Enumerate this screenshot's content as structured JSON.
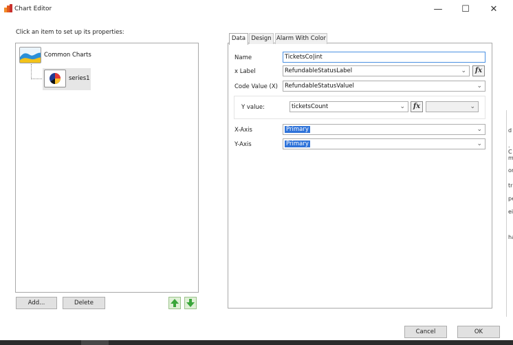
{
  "window": {
    "title": "Chart Editor",
    "minimize": "—",
    "maximize": "☐",
    "close": "✕"
  },
  "left": {
    "caption": "Click an item to set up  its properties:",
    "tree": [
      {
        "label": "Common Charts",
        "icon": "area-chart-icon"
      },
      {
        "label": "series1",
        "icon": "pie-chart-icon"
      }
    ],
    "add_label": "Add...",
    "delete_label": "Delete"
  },
  "tabs": [
    "Data",
    "Design",
    "Alarm With Color"
  ],
  "form": {
    "name_label": "Name",
    "name_value": "TicketsCo|int",
    "xlabel_label": "x Label",
    "xlabel_value": "RefundableStatusLabel",
    "code_label": "Code Value (X)",
    "code_value": "RefundableStatusValuel",
    "y_label": "Y value:",
    "y_value": "ticketsCount",
    "y_extra": "",
    "xaxis_label": "X-Axis",
    "xaxis_value": "Primary",
    "yaxis_label": "Y-Axis",
    "yaxis_value": "Primary",
    "fx_label": "fx"
  },
  "footer": {
    "cancel_label": "Cancel",
    "ok_label": "OK"
  },
  "edge_text": [
    "d",
    ". C",
    "m",
    "or",
    "tr",
    "pe",
    "ei",
    "ha"
  ],
  "colors": {
    "accent": "#2f73d9",
    "focus_border": "#4a90e2",
    "arrow_green": "#3aa63a"
  }
}
